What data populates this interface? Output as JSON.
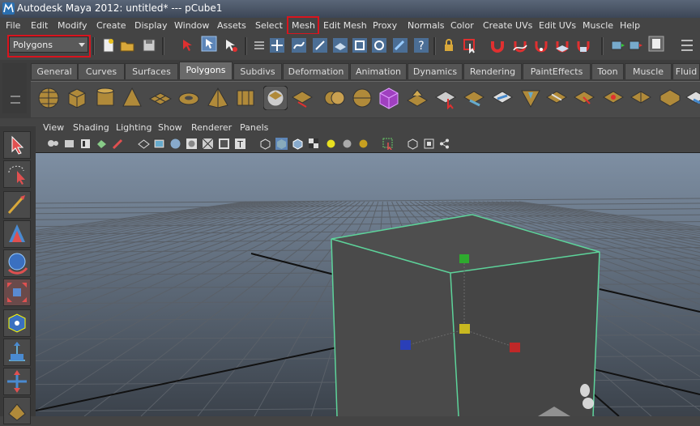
{
  "window": {
    "title": "Autodesk Maya 2012: untitled*   ---   pCube1"
  },
  "menubar": {
    "items": [
      "File",
      "Edit",
      "Modify",
      "Create",
      "Display",
      "Window",
      "Assets",
      "Select",
      "Mesh",
      "Edit Mesh",
      "Proxy",
      "Normals",
      "Color",
      "Create UVs",
      "Edit UVs",
      "Muscle",
      "Help"
    ],
    "highlighted": "Mesh"
  },
  "mode_selector": {
    "value": "Polygons"
  },
  "shelf": {
    "tabs": [
      "General",
      "Curves",
      "Surfaces",
      "Polygons",
      "Subdivs",
      "Deformation",
      "Animation",
      "Dynamics",
      "Rendering",
      "PaintEffects",
      "Toon",
      "Muscle",
      "Fluid"
    ],
    "active_tab": "Polygons"
  },
  "panel_menu": {
    "items": [
      "View",
      "Shading",
      "Lighting",
      "Show",
      "Renderer",
      "Panels"
    ]
  },
  "viewport": {
    "object": "pCube1",
    "wire_color": "#5dd39a",
    "cube_color": "#4a4a4a"
  },
  "colors": {
    "highlight": "#d9141e",
    "wire": "#5dd39a"
  }
}
